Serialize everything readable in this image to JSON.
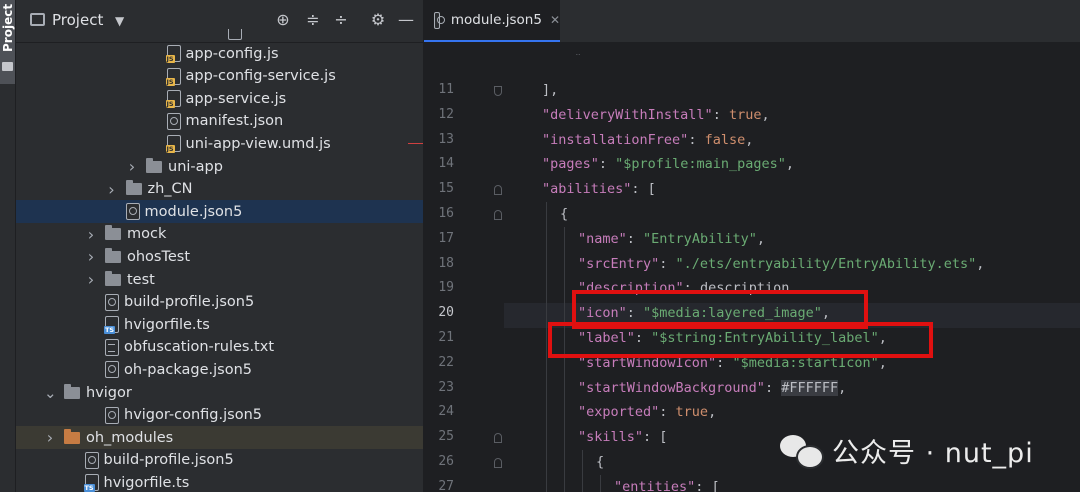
{
  "stripe": {
    "label": "Project"
  },
  "panel": {
    "title": "Project",
    "header_icons": [
      "target-icon",
      "expand-all-icon",
      "collapse-all-icon",
      "gear-icon",
      "minimize-icon"
    ]
  },
  "tree": [
    {
      "label": "app-config.js",
      "depth": 5,
      "type": "file",
      "icon": "js"
    },
    {
      "label": "app-config-service.js",
      "depth": 5,
      "type": "file",
      "icon": "js"
    },
    {
      "label": "app-service.js",
      "depth": 5,
      "type": "file",
      "icon": "js"
    },
    {
      "label": "manifest.json",
      "depth": 5,
      "type": "file",
      "icon": "json"
    },
    {
      "label": "uni-app-view.umd.js",
      "depth": 5,
      "type": "file",
      "icon": "js"
    },
    {
      "label": "uni-app",
      "depth": 4,
      "type": "folder",
      "expanded": false
    },
    {
      "label": "zh_CN",
      "depth": 3,
      "type": "folder",
      "expanded": false
    },
    {
      "label": "module.json5",
      "depth": 3,
      "type": "file",
      "icon": "json",
      "selected": true
    },
    {
      "label": "mock",
      "depth": 2,
      "type": "folder",
      "expanded": false
    },
    {
      "label": "ohosTest",
      "depth": 2,
      "type": "folder",
      "expanded": false
    },
    {
      "label": "test",
      "depth": 2,
      "type": "folder",
      "expanded": false
    },
    {
      "label": "build-profile.json5",
      "depth": 2,
      "type": "file",
      "icon": "json"
    },
    {
      "label": "hvigorfile.ts",
      "depth": 2,
      "type": "file",
      "icon": "ts"
    },
    {
      "label": "obfuscation-rules.txt",
      "depth": 2,
      "type": "file",
      "icon": "txt"
    },
    {
      "label": "oh-package.json5",
      "depth": 2,
      "type": "file",
      "icon": "json"
    },
    {
      "label": "hvigor",
      "depth": 0,
      "type": "folder",
      "expanded": true
    },
    {
      "label": "hvigor-config.json5",
      "depth": 2,
      "type": "file",
      "icon": "json"
    },
    {
      "label": "oh_modules",
      "depth": 0,
      "type": "folder",
      "expanded": false,
      "color": "orange",
      "highlight": true
    },
    {
      "label": "build-profile.json5",
      "depth": 1,
      "type": "file",
      "icon": "json"
    },
    {
      "label": "hvigorfile.ts",
      "depth": 1,
      "type": "file",
      "icon": "ts"
    }
  ],
  "editor": {
    "tab_label": "module.json5",
    "current_line": 20,
    "lines": [
      {
        "n": "11",
        "indent": 0,
        "tokens": [
          [
            "p",
            "],"
          ]
        ]
      },
      {
        "n": "12",
        "indent": 0,
        "tokens": [
          [
            "k",
            "\"deliveryWithInstall\""
          ],
          [
            "p",
            ": "
          ],
          [
            "b",
            "true"
          ],
          [
            "p",
            ","
          ]
        ]
      },
      {
        "n": "13",
        "indent": 0,
        "tokens": [
          [
            "k",
            "\"installationFree\""
          ],
          [
            "p",
            ": "
          ],
          [
            "b",
            "false"
          ],
          [
            "p",
            ","
          ]
        ]
      },
      {
        "n": "14",
        "indent": 0,
        "tokens": [
          [
            "k",
            "\"pages\""
          ],
          [
            "p",
            ": "
          ],
          [
            "s",
            "\"$profile:main_pages\""
          ],
          [
            "p",
            ","
          ]
        ]
      },
      {
        "n": "15",
        "indent": 0,
        "tokens": [
          [
            "k",
            "\"abilities\""
          ],
          [
            "p",
            ": ["
          ]
        ]
      },
      {
        "n": "16",
        "indent": 1,
        "tokens": [
          [
            "p",
            "{"
          ]
        ]
      },
      {
        "n": "17",
        "indent": 2,
        "tokens": [
          [
            "k",
            "\"name\""
          ],
          [
            "p",
            ": "
          ],
          [
            "s",
            "\"EntryAbility\""
          ],
          [
            "p",
            ","
          ]
        ]
      },
      {
        "n": "18",
        "indent": 2,
        "tokens": [
          [
            "k",
            "\"srcEntry\""
          ],
          [
            "p",
            ": "
          ],
          [
            "s",
            "\"./ets/entryability/EntryAbility.ets\""
          ],
          [
            "p",
            ","
          ]
        ]
      },
      {
        "n": "19",
        "indent": 2,
        "tokens": [
          [
            "k",
            "\"description\""
          ],
          [
            "p",
            ": "
          ],
          [
            "p",
            "description"
          ],
          [
            "p",
            ","
          ]
        ]
      },
      {
        "n": "20",
        "indent": 2,
        "tokens": [
          [
            "k",
            "\"icon\""
          ],
          [
            "p",
            ": "
          ],
          [
            "s",
            "\"$media:layered_image\""
          ],
          [
            "p",
            ","
          ]
        ]
      },
      {
        "n": "21",
        "indent": 2,
        "tokens": [
          [
            "k",
            "\"label\""
          ],
          [
            "p",
            ": "
          ],
          [
            "s",
            "\"$string:EntryAbility_label\""
          ],
          [
            "p",
            ","
          ]
        ]
      },
      {
        "n": "22",
        "indent": 2,
        "tokens": [
          [
            "k",
            "\"startWindowIcon\""
          ],
          [
            "p",
            ": "
          ],
          [
            "s",
            "\"$media:startIcon\""
          ],
          [
            "p",
            ","
          ]
        ]
      },
      {
        "n": "23",
        "indent": 2,
        "tokens": [
          [
            "k",
            "\"startWindowBackground\""
          ],
          [
            "p",
            ": "
          ],
          [
            "h",
            "#FFFFFF"
          ],
          [
            "p",
            ","
          ]
        ]
      },
      {
        "n": "24",
        "indent": 2,
        "tokens": [
          [
            "k",
            "\"exported\""
          ],
          [
            "p",
            ": "
          ],
          [
            "b",
            "true"
          ],
          [
            "p",
            ","
          ]
        ]
      },
      {
        "n": "25",
        "indent": 2,
        "tokens": [
          [
            "k",
            "\"skills\""
          ],
          [
            "p",
            ": ["
          ]
        ]
      },
      {
        "n": "26",
        "indent": 3,
        "tokens": [
          [
            "p",
            "{"
          ]
        ]
      },
      {
        "n": "27",
        "indent": 4,
        "tokens": [
          [
            "k",
            "\"entities\""
          ],
          [
            "p",
            ": ["
          ]
        ]
      }
    ]
  },
  "watermark": {
    "text": "公众号 · nut_pi"
  },
  "colors": {
    "accent": "#3574f0",
    "annotation_red": "#e01010"
  }
}
